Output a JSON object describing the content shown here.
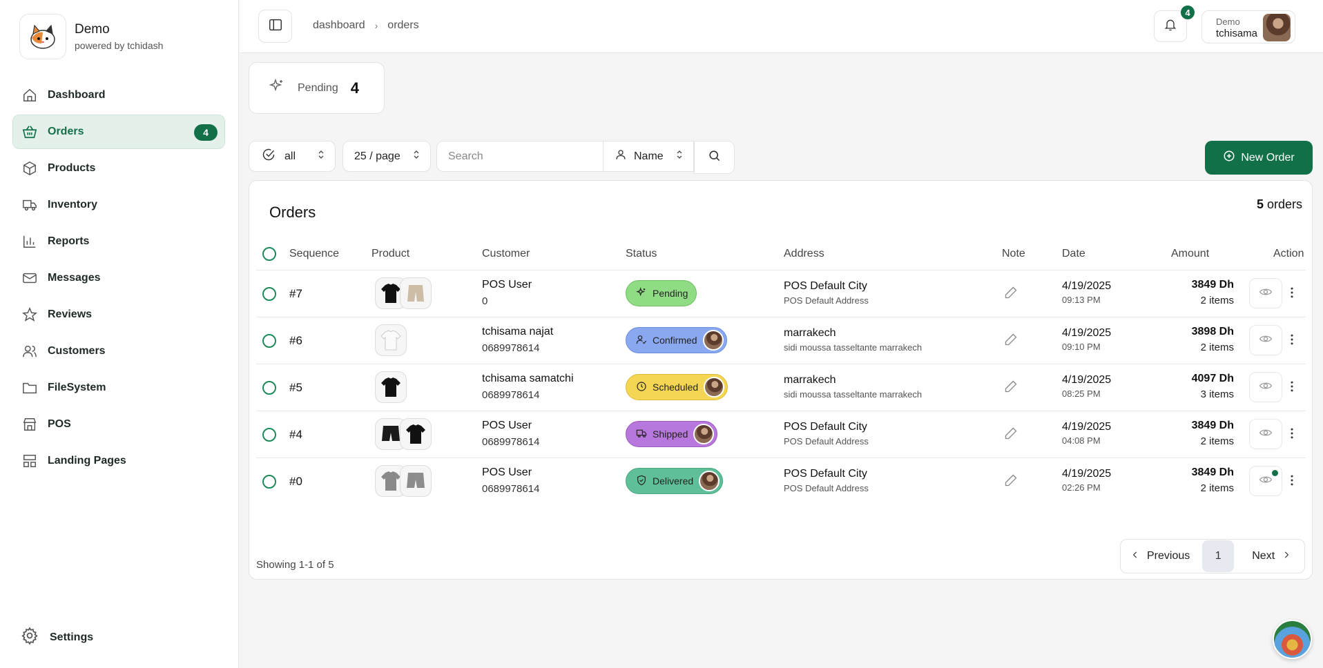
{
  "brand": {
    "name": "Demo",
    "subtitle": "powered by tchidash"
  },
  "nav": [
    {
      "label": "Dashboard",
      "icon": "home-icon"
    },
    {
      "label": "Orders",
      "icon": "basket-icon",
      "badge": "4",
      "active": true
    },
    {
      "label": "Products",
      "icon": "box-icon"
    },
    {
      "label": "Inventory",
      "icon": "truck-icon"
    },
    {
      "label": "Reports",
      "icon": "bar-chart-icon"
    },
    {
      "label": "Messages",
      "icon": "mail-icon"
    },
    {
      "label": "Reviews",
      "icon": "star-icon"
    },
    {
      "label": "Customers",
      "icon": "users-icon"
    },
    {
      "label": "FileSystem",
      "icon": "folder-icon"
    },
    {
      "label": "POS",
      "icon": "store-icon"
    },
    {
      "label": "Landing Pages",
      "icon": "layout-icon"
    }
  ],
  "settings_label": "Settings",
  "breadcrumb": {
    "first": "dashboard",
    "second": "orders"
  },
  "notifications": {
    "count": "4"
  },
  "user": {
    "role": "Demo",
    "name": "tchisama"
  },
  "stat": {
    "label": "Pending",
    "value": "4"
  },
  "filters": {
    "status": "all",
    "per_page": "25 / page",
    "search_placeholder": "Search",
    "search_value": "",
    "field": "Name"
  },
  "new_order_label": "New Order",
  "panel": {
    "title": "Orders",
    "count_num": "5",
    "count_label": "orders"
  },
  "columns": {
    "sequence": "Sequence",
    "product": "Product",
    "customer": "Customer",
    "status": "Status",
    "address": "Address",
    "note": "Note",
    "date": "Date",
    "amount": "Amount",
    "action": "Action"
  },
  "rows": [
    {
      "seq": "#7",
      "customer": "POS User",
      "phone": "0",
      "status": "Pending",
      "city": "POS Default City",
      "address": "POS Default Address",
      "date": "4/19/2025",
      "time": "09:13 PM",
      "amount": "3849 Dh",
      "items": "2 items"
    },
    {
      "seq": "#6",
      "customer": "tchisama najat",
      "phone": "0689978614",
      "status": "Confirmed",
      "city": "marrakech",
      "address": "sidi moussa tasseltante marrakech",
      "date": "4/19/2025",
      "time": "09:10 PM",
      "amount": "3898 Dh",
      "items": "2 items"
    },
    {
      "seq": "#5",
      "customer": "tchisama samatchi",
      "phone": "0689978614",
      "status": "Scheduled",
      "city": "marrakech",
      "address": "sidi moussa tasseltante marrakech",
      "date": "4/19/2025",
      "time": "08:25 PM",
      "amount": "4097 Dh",
      "items": "3 items"
    },
    {
      "seq": "#4",
      "customer": "POS User",
      "phone": "0689978614",
      "status": "Shipped",
      "city": "POS Default City",
      "address": "POS Default Address",
      "date": "4/19/2025",
      "time": "04:08 PM",
      "amount": "3849 Dh",
      "items": "2 items"
    },
    {
      "seq": "#0",
      "customer": "POS User",
      "phone": "0689978614",
      "status": "Delivered",
      "city": "POS Default City",
      "address": "POS Default Address",
      "date": "4/19/2025",
      "time": "02:26 PM",
      "amount": "3849 Dh",
      "items": "2 items"
    }
  ],
  "status_colors": {
    "Pending": "#8fdc84",
    "Confirmed": "#8aa8f0",
    "Scheduled": "#f5d654",
    "Shipped": "#b877dc",
    "Delivered": "#5fbf99"
  },
  "accent": "#127049",
  "pagination": {
    "showing": "Showing 1-1 of 5",
    "prev": "Previous",
    "page": "1",
    "next": "Next"
  }
}
